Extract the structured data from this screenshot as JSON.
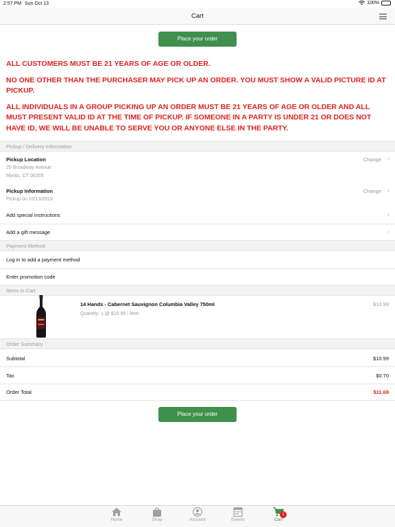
{
  "status_bar": {
    "time": "2:57 PM",
    "date": "Sun Oct 13",
    "battery": "100%"
  },
  "nav": {
    "title": "Cart"
  },
  "place_order_label": "Place your order",
  "warnings": [
    "ALL CUSTOMERS MUST BE 21 YEARS OF AGE OR OLDER.",
    "NO ONE OTHER THAN THE PURCHASER MAY PICK UP AN ORDER.  YOU MUST SHOW A VALID PICTURE ID AT PICKUP.",
    "ALL INDIVIDUALS IN A GROUP PICKING UP AN ORDER MUST BE 21 YEARS OF AGE OR OLDER AND ALL MUST PRESENT VALID ID AT THE TIME OF PICKUP.  IF SOMEONE IN A PARTY IS UNDER 21 OR DOES NOT HAVE ID, WE WILL BE UNABLE TO SERVE YOU OR ANYONE ELSE IN THE PARTY."
  ],
  "pickup": {
    "section_header": "Pickup / Delivery Information",
    "location_label": "Pickup Location",
    "address_line1": "25 Broadway Avenue",
    "address_line2": "Mystic, CT 06355",
    "change_label": "Change",
    "info_label": "Pickup Information",
    "info_value": "Pickup on 10/13/2019",
    "special_instructions": "Add special instructions",
    "gift_message": "Add a gift message"
  },
  "payment": {
    "section_header": "Payment Method",
    "login_label": "Log in to add a payment method",
    "promo_label": "Enter promotion code"
  },
  "cart": {
    "section_header": "Items in Cart",
    "item_name": "14 Hands - Cabernet Sauvignon Columbia Valley 750ml",
    "item_qty": "Quantity: 1 @ $10.99 / item",
    "item_price": "$10.99"
  },
  "summary": {
    "section_header": "Order Summary",
    "subtotal_label": "Subtotal",
    "subtotal_value": "$10.99",
    "tax_label": "Tax",
    "tax_value": "$0.70",
    "total_label": "Order Total",
    "total_value": "$11.69"
  },
  "tabs": [
    {
      "label": "Home",
      "icon": "home-icon"
    },
    {
      "label": "Shop",
      "icon": "shopping-bag-icon"
    },
    {
      "label": "Account",
      "icon": "account-icon"
    },
    {
      "label": "Events",
      "icon": "calendar-icon"
    },
    {
      "label": "Cart",
      "icon": "cart-icon",
      "badge": "1"
    }
  ],
  "colors": {
    "accent_green": "#3f8f4d",
    "warning_red": "#e02020",
    "muted_gray": "#9a9a9a"
  }
}
